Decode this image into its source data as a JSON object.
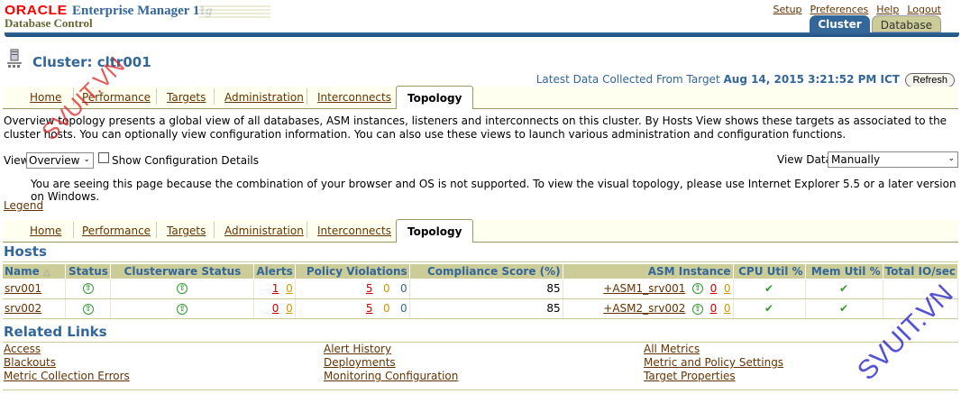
{
  "header": {
    "oracle_logo": "ORACLE",
    "product_em": "Enterprise Manager",
    "product_ver": "11",
    "product_g": "g",
    "subtitle": "Database Control",
    "global_links": [
      "Setup",
      "Preferences",
      "Help",
      "Logout"
    ],
    "top_tabs": [
      {
        "label": "Cluster",
        "active": true
      },
      {
        "label": "Database",
        "active": false
      }
    ]
  },
  "page": {
    "title": "Cluster: cltr001",
    "latest_prefix": "Latest Data Collected From Target",
    "latest_time": "Aug 14, 2015 3:21:52 PM ICT",
    "refresh_label": "Refresh",
    "tabs": [
      "Home",
      "Performance",
      "Targets",
      "Administration",
      "Interconnects",
      "Topology"
    ],
    "active_tab": "Topology",
    "description": "Overview topology presents a global view of all databases, ASM instances, listeners and interconnects on this cluster. By Hosts View shows these targets as associated to the cluster hosts. You can optionally view configuration information. You can also use these views to launch various administration and configuration functions.",
    "view_label": "View",
    "view_value": "Overview",
    "show_config_label": "Show Configuration Details",
    "view_data_label": "View Data",
    "view_data_value": "Manually",
    "browser_msg": "You are seeing this page because the combination of your browser and OS is not supported. To view the visual topology, please use Internet Explorer 5.5 or a later version on Windows.",
    "legend_label": "Legend"
  },
  "hosts": {
    "heading": "Hosts",
    "columns": [
      "Name",
      "Status",
      "Clusterware Status",
      "Alerts",
      "Policy Violations",
      "Compliance Score (%)",
      "ASM Instance",
      "CPU Util %",
      "Mem Util %",
      "Total IO/sec"
    ],
    "rows": [
      {
        "name": "srv001",
        "alert_crit": "1",
        "alert_warn": "0",
        "pv_crit": "5",
        "pv_warn": "0",
        "pv_info": "0",
        "compliance": "85",
        "asm": "+ASM1_srv001",
        "asm_a": "0",
        "asm_b": "0"
      },
      {
        "name": "srv002",
        "alert_crit": "0",
        "alert_warn": "0",
        "pv_crit": "5",
        "pv_warn": "0",
        "pv_info": "0",
        "compliance": "85",
        "asm": "+ASM2_srv002",
        "asm_a": "0",
        "asm_b": "0"
      }
    ]
  },
  "related": {
    "heading": "Related Links",
    "col1": [
      "Access",
      "Blackouts",
      "Metric Collection Errors"
    ],
    "col2": [
      "Alert History",
      "Deployments",
      "Monitoring Configuration"
    ],
    "col3": [
      "All Metrics",
      "Metric and Policy Settings",
      "Target Properties"
    ]
  },
  "watermarks": [
    "SVUIT.VN",
    "SVUIT.VN"
  ]
}
